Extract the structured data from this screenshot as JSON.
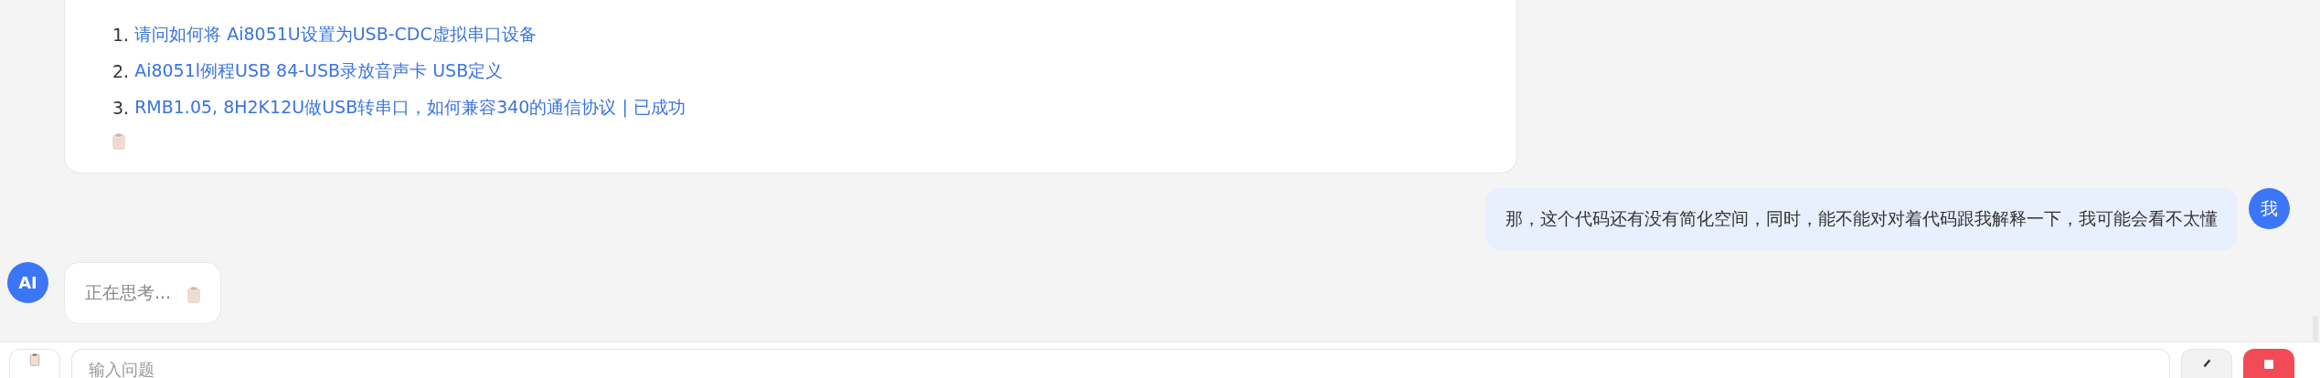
{
  "reference_card": {
    "items": [
      {
        "number": "1.",
        "title": "请问如何将 Ai8051U设置为USB-CDC虚拟串口设备"
      },
      {
        "number": "2.",
        "title": "Ai8051l例程USB 84-USB录放音声卡 USB定义"
      },
      {
        "number": "3.",
        "title": "RMB1.05, 8H2K12U做USB转串口，如何兼容340的通信协议 | 已成功"
      }
    ]
  },
  "user_message": {
    "avatar": "我",
    "text": "那，这个代码还有没有简化空间，同时，能不能对对着代码跟我解释一下，我可能会看不太懂"
  },
  "ai_message": {
    "avatar": "AI",
    "text": "正在思考..."
  },
  "composer": {
    "placeholder": "输入问题"
  }
}
